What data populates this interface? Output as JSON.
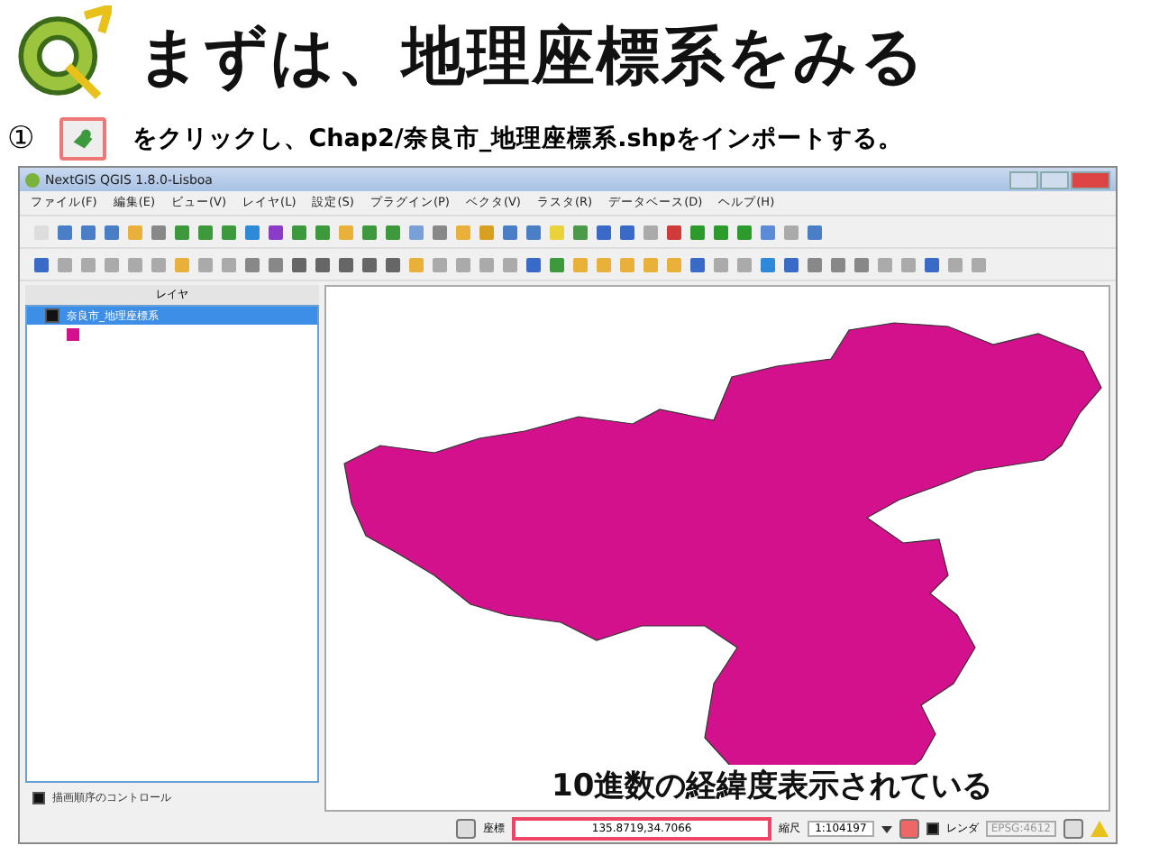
{
  "slide": {
    "title": "まずは、地理座標系をみる",
    "step_number": "①",
    "instruction": "をクリックし、Chap2/奈良市_地理座標系.shpをインポートする。"
  },
  "window": {
    "title": "NextGIS QGIS 1.8.0-Lisboa",
    "menu": [
      "ファイル(F)",
      "編集(E)",
      "ビュー(V)",
      "レイヤ(L)",
      "設定(S)",
      "プラグイン(P)",
      "ベクタ(V)",
      "ラスタ(R)",
      "データベース(D)",
      "ヘルプ(H)"
    ],
    "layers_panel": {
      "title": "レイヤ",
      "layers": [
        {
          "name": "奈良市_地理座標系",
          "checked": true,
          "color": "#d4118c"
        }
      ],
      "render_order": {
        "label": "描画順序のコントロール",
        "checked": true
      }
    },
    "status_bar": {
      "coordinate_label": "座標",
      "coordinate_value": "135.8719,34.7066",
      "scale_label": "縮尺",
      "scale_value": "1:104197",
      "render_label": "レンダ",
      "render_checked": true,
      "crs": "EPSG:4612"
    }
  },
  "caption": "10進数の経緯度表示されている"
}
